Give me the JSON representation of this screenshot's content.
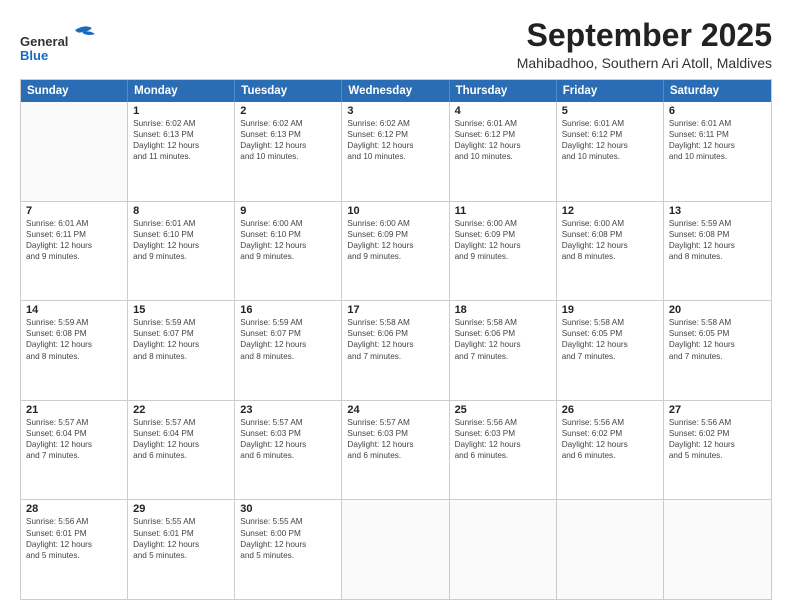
{
  "header": {
    "logo_general": "General",
    "logo_blue": "Blue",
    "month_year": "September 2025",
    "location": "Mahibadhoo, Southern Ari Atoll, Maldives"
  },
  "days_of_week": [
    "Sunday",
    "Monday",
    "Tuesday",
    "Wednesday",
    "Thursday",
    "Friday",
    "Saturday"
  ],
  "weeks": [
    [
      {
        "day": "",
        "sunrise": "",
        "sunset": "",
        "daylight": ""
      },
      {
        "day": "1",
        "sunrise": "Sunrise: 6:02 AM",
        "sunset": "Sunset: 6:13 PM",
        "daylight": "Daylight: 12 hours and 11 minutes."
      },
      {
        "day": "2",
        "sunrise": "Sunrise: 6:02 AM",
        "sunset": "Sunset: 6:13 PM",
        "daylight": "Daylight: 12 hours and 10 minutes."
      },
      {
        "day": "3",
        "sunrise": "Sunrise: 6:02 AM",
        "sunset": "Sunset: 6:12 PM",
        "daylight": "Daylight: 12 hours and 10 minutes."
      },
      {
        "day": "4",
        "sunrise": "Sunrise: 6:01 AM",
        "sunset": "Sunset: 6:12 PM",
        "daylight": "Daylight: 12 hours and 10 minutes."
      },
      {
        "day": "5",
        "sunrise": "Sunrise: 6:01 AM",
        "sunset": "Sunset: 6:12 PM",
        "daylight": "Daylight: 12 hours and 10 minutes."
      },
      {
        "day": "6",
        "sunrise": "Sunrise: 6:01 AM",
        "sunset": "Sunset: 6:11 PM",
        "daylight": "Daylight: 12 hours and 10 minutes."
      }
    ],
    [
      {
        "day": "7",
        "sunrise": "Sunrise: 6:01 AM",
        "sunset": "Sunset: 6:11 PM",
        "daylight": "Daylight: 12 hours and 9 minutes."
      },
      {
        "day": "8",
        "sunrise": "Sunrise: 6:01 AM",
        "sunset": "Sunset: 6:10 PM",
        "daylight": "Daylight: 12 hours and 9 minutes."
      },
      {
        "day": "9",
        "sunrise": "Sunrise: 6:00 AM",
        "sunset": "Sunset: 6:10 PM",
        "daylight": "Daylight: 12 hours and 9 minutes."
      },
      {
        "day": "10",
        "sunrise": "Sunrise: 6:00 AM",
        "sunset": "Sunset: 6:09 PM",
        "daylight": "Daylight: 12 hours and 9 minutes."
      },
      {
        "day": "11",
        "sunrise": "Sunrise: 6:00 AM",
        "sunset": "Sunset: 6:09 PM",
        "daylight": "Daylight: 12 hours and 9 minutes."
      },
      {
        "day": "12",
        "sunrise": "Sunrise: 6:00 AM",
        "sunset": "Sunset: 6:08 PM",
        "daylight": "Daylight: 12 hours and 8 minutes."
      },
      {
        "day": "13",
        "sunrise": "Sunrise: 5:59 AM",
        "sunset": "Sunset: 6:08 PM",
        "daylight": "Daylight: 12 hours and 8 minutes."
      }
    ],
    [
      {
        "day": "14",
        "sunrise": "Sunrise: 5:59 AM",
        "sunset": "Sunset: 6:08 PM",
        "daylight": "Daylight: 12 hours and 8 minutes."
      },
      {
        "day": "15",
        "sunrise": "Sunrise: 5:59 AM",
        "sunset": "Sunset: 6:07 PM",
        "daylight": "Daylight: 12 hours and 8 minutes."
      },
      {
        "day": "16",
        "sunrise": "Sunrise: 5:59 AM",
        "sunset": "Sunset: 6:07 PM",
        "daylight": "Daylight: 12 hours and 8 minutes."
      },
      {
        "day": "17",
        "sunrise": "Sunrise: 5:58 AM",
        "sunset": "Sunset: 6:06 PM",
        "daylight": "Daylight: 12 hours and 7 minutes."
      },
      {
        "day": "18",
        "sunrise": "Sunrise: 5:58 AM",
        "sunset": "Sunset: 6:06 PM",
        "daylight": "Daylight: 12 hours and 7 minutes."
      },
      {
        "day": "19",
        "sunrise": "Sunrise: 5:58 AM",
        "sunset": "Sunset: 6:05 PM",
        "daylight": "Daylight: 12 hours and 7 minutes."
      },
      {
        "day": "20",
        "sunrise": "Sunrise: 5:58 AM",
        "sunset": "Sunset: 6:05 PM",
        "daylight": "Daylight: 12 hours and 7 minutes."
      }
    ],
    [
      {
        "day": "21",
        "sunrise": "Sunrise: 5:57 AM",
        "sunset": "Sunset: 6:04 PM",
        "daylight": "Daylight: 12 hours and 7 minutes."
      },
      {
        "day": "22",
        "sunrise": "Sunrise: 5:57 AM",
        "sunset": "Sunset: 6:04 PM",
        "daylight": "Daylight: 12 hours and 6 minutes."
      },
      {
        "day": "23",
        "sunrise": "Sunrise: 5:57 AM",
        "sunset": "Sunset: 6:03 PM",
        "daylight": "Daylight: 12 hours and 6 minutes."
      },
      {
        "day": "24",
        "sunrise": "Sunrise: 5:57 AM",
        "sunset": "Sunset: 6:03 PM",
        "daylight": "Daylight: 12 hours and 6 minutes."
      },
      {
        "day": "25",
        "sunrise": "Sunrise: 5:56 AM",
        "sunset": "Sunset: 6:03 PM",
        "daylight": "Daylight: 12 hours and 6 minutes."
      },
      {
        "day": "26",
        "sunrise": "Sunrise: 5:56 AM",
        "sunset": "Sunset: 6:02 PM",
        "daylight": "Daylight: 12 hours and 6 minutes."
      },
      {
        "day": "27",
        "sunrise": "Sunrise: 5:56 AM",
        "sunset": "Sunset: 6:02 PM",
        "daylight": "Daylight: 12 hours and 5 minutes."
      }
    ],
    [
      {
        "day": "28",
        "sunrise": "Sunrise: 5:56 AM",
        "sunset": "Sunset: 6:01 PM",
        "daylight": "Daylight: 12 hours and 5 minutes."
      },
      {
        "day": "29",
        "sunrise": "Sunrise: 5:55 AM",
        "sunset": "Sunset: 6:01 PM",
        "daylight": "Daylight: 12 hours and 5 minutes."
      },
      {
        "day": "30",
        "sunrise": "Sunrise: 5:55 AM",
        "sunset": "Sunset: 6:00 PM",
        "daylight": "Daylight: 12 hours and 5 minutes."
      },
      {
        "day": "",
        "sunrise": "",
        "sunset": "",
        "daylight": ""
      },
      {
        "day": "",
        "sunrise": "",
        "sunset": "",
        "daylight": ""
      },
      {
        "day": "",
        "sunrise": "",
        "sunset": "",
        "daylight": ""
      },
      {
        "day": "",
        "sunrise": "",
        "sunset": "",
        "daylight": ""
      }
    ]
  ]
}
